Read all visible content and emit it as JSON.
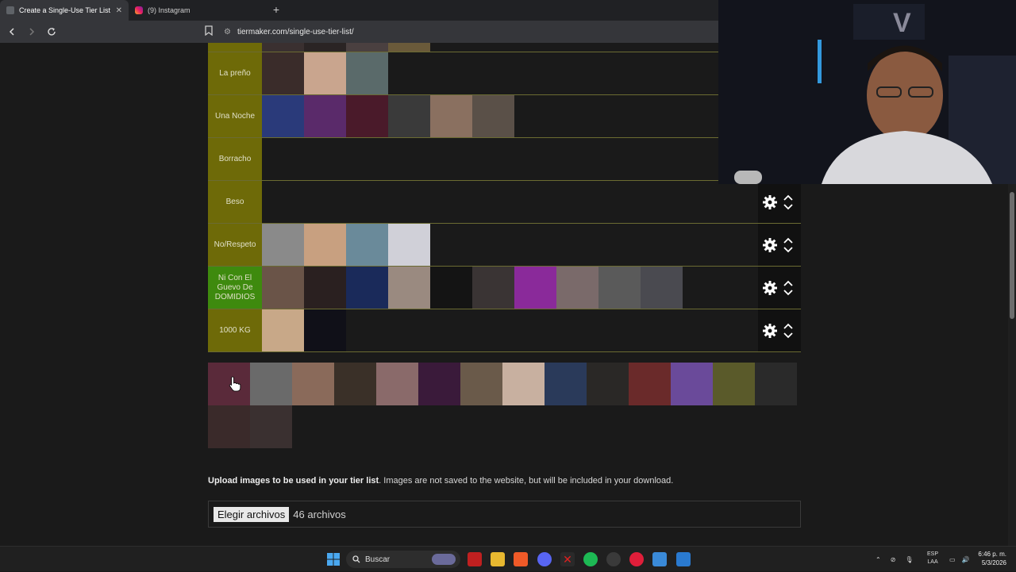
{
  "browser": {
    "tabs": [
      {
        "title": "Create a Single-Use Tier List (Pri",
        "close": "✕"
      },
      {
        "title": "(9) Instagram"
      }
    ],
    "new_tab_label": "+",
    "url": "tiermaker.com/single-use-tier-list/"
  },
  "tiers": [
    {
      "label": "La preño",
      "color": "#6e6a08",
      "item_colors": [
        "#3a2c2a",
        "#c9a58e",
        "#5a6a6a"
      ]
    },
    {
      "label": "Una Noche",
      "color": "#6e6a08",
      "item_colors": [
        "#2a3a7a",
        "#5a2a6a",
        "#4a1a2a",
        "#3a3a3a",
        "#8a7060",
        "#5a5048"
      ]
    },
    {
      "label": "Borracho",
      "color": "#6e6a08",
      "item_colors": []
    },
    {
      "label": "Beso",
      "color": "#6e6a08",
      "item_colors": []
    },
    {
      "label": "No/Respeto",
      "color": "#6e6a08",
      "item_colors": [
        "#8a8a8a",
        "#c8a080",
        "#6a8a9a",
        "#d0d0d8"
      ]
    },
    {
      "label": "Ni Con El Guevo De DOMIDIOS",
      "color": "#3e8a0e",
      "item_colors": [
        "#6a5448",
        "#2a2020",
        "#1a2a5a",
        "#9a8a80",
        "#141414",
        "#3a3434",
        "#8a2a9a",
        "#7a6a6a",
        "#5a5a5a",
        "#4a4a50"
      ]
    },
    {
      "label": "1000 KG",
      "color": "#6e6a08",
      "item_colors": [
        "#c8a888",
        "#101018"
      ]
    }
  ],
  "pool_colors": [
    "#5a2a3a",
    "#6a6a6a",
    "#8a6a5a",
    "#3a3028",
    "#8a6a6a",
    "#3a1a3a",
    "#6a5a4a",
    "#c8b0a0",
    "#2a3a5a",
    "#2a2826",
    "#6a2a2a",
    "#6a4a9a",
    "#5a5a2a",
    "#2a2a2a",
    "#3a2a2a"
  ],
  "upload": {
    "bold": "Upload images to be used in your tier list",
    "rest": ". Images are not saved to the website, but will be included in your download.",
    "button": "Elegir archivos",
    "count": "46 archivos"
  },
  "taskbar": {
    "search_placeholder": "Buscar",
    "lang_top": "ESP",
    "lang_bottom": "LAA",
    "time": "6:46 p. m.",
    "date": "5/3/2026"
  }
}
